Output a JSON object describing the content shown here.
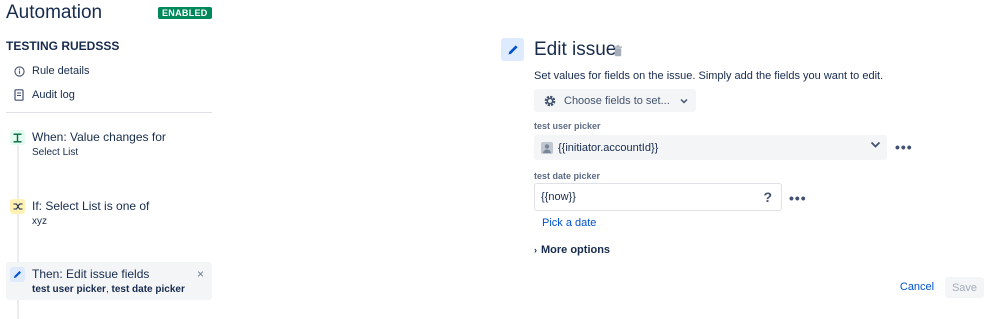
{
  "app": {
    "title": "Automation",
    "status_badge": "ENABLED"
  },
  "rule": {
    "name": "TESTING RUEDSSS"
  },
  "sidebar": {
    "links": [
      {
        "label": "Rule details",
        "icon": "info-icon"
      },
      {
        "label": "Audit log",
        "icon": "document-icon"
      }
    ],
    "steps": [
      {
        "kind": "trigger",
        "title": "When: Value changes for",
        "subtitle": "Select List",
        "icon": "trigger-icon",
        "color": "#e3fcef"
      },
      {
        "kind": "condition",
        "title": "If: Select List is one of",
        "subtitle": "xyz",
        "icon": "shuffle-icon",
        "color": "#fff0b3"
      },
      {
        "kind": "action",
        "title": "Then: Edit issue fields",
        "subtitle_part1": "test user picker",
        "subtitle_sep": ", ",
        "subtitle_part2": "test date picker",
        "icon": "pencil-icon",
        "color": "#deebff",
        "close": "×"
      }
    ]
  },
  "main": {
    "title": "Edit issue",
    "description": "Set values for fields on the issue. Simply add the fields you want to edit.",
    "choose_fields_label": "Choose fields to set...",
    "fields": [
      {
        "label": "test user picker",
        "value": "{{initiator.accountId}}"
      },
      {
        "label": "test date picker",
        "value": "{{now}}",
        "help": "?",
        "link": "Pick a date"
      }
    ],
    "more_options": "More options",
    "cancel_label": "Cancel",
    "save_label": "Save"
  },
  "colors": {
    "accent": "#0052cc",
    "enabled": "#00875a",
    "text": "#172b4d"
  }
}
